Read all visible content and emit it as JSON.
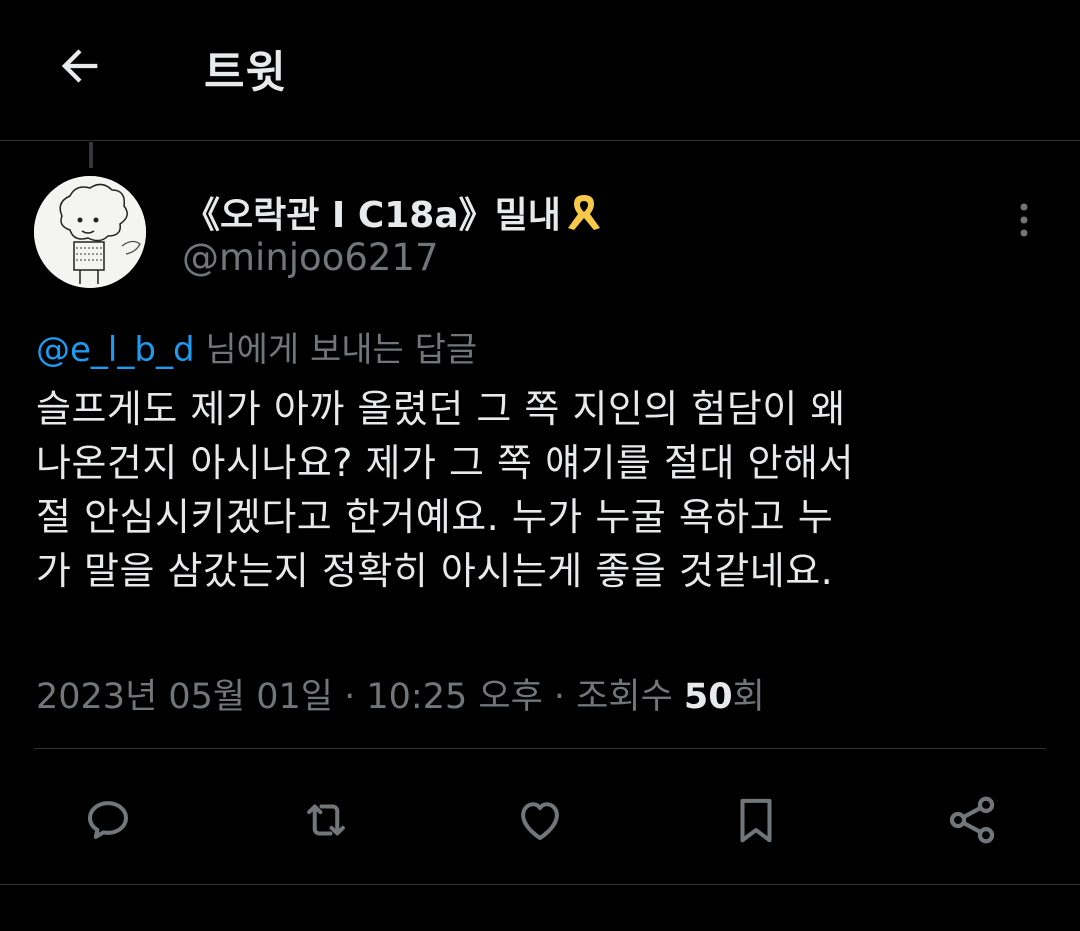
{
  "header": {
    "title": "트윗",
    "back_icon": "arrow-left-icon"
  },
  "tweet": {
    "author": {
      "display_name": "《오락관 I C18a》밀내",
      "badge_icon": "yellow-ribbon-icon",
      "handle": "@minjoo6217"
    },
    "reply_to": {
      "mention": "@e_l_b_d",
      "suffix": " 님에게 보내는 답글"
    },
    "text_lines": [
      "슬프게도 제가 아까 올렸던 그 쪽 지인의 험담이 왜",
      "나온건지 아시나요? 제가 그 쪽 얘기를 절대 안해서",
      "절 안심시키겠다고 한거예요. 누가 누굴 욕하고 누",
      "가 말을 삼갔는지 정확히 아시는게 좋을 것같네요."
    ],
    "meta": {
      "date": "2023년 05월 01일",
      "time": "10:25 오후",
      "views_prefix": "조회수 ",
      "views_count": "50",
      "views_suffix": "회",
      "separator": " · "
    }
  },
  "actions": [
    {
      "name": "reply-button",
      "icon": "comment-bubble-icon"
    },
    {
      "name": "retweet-button",
      "icon": "retweet-icon"
    },
    {
      "name": "like-button",
      "icon": "heart-icon"
    },
    {
      "name": "bookmark-button",
      "icon": "bookmark-icon"
    },
    {
      "name": "share-button",
      "icon": "share-icon"
    }
  ],
  "colors": {
    "background": "#000000",
    "text_primary": "#e7e9ea",
    "text_secondary": "#71767b",
    "accent_blue": "#1d9bf0",
    "ribbon_yellow": "#f7c948",
    "divider": "#2f3336"
  }
}
